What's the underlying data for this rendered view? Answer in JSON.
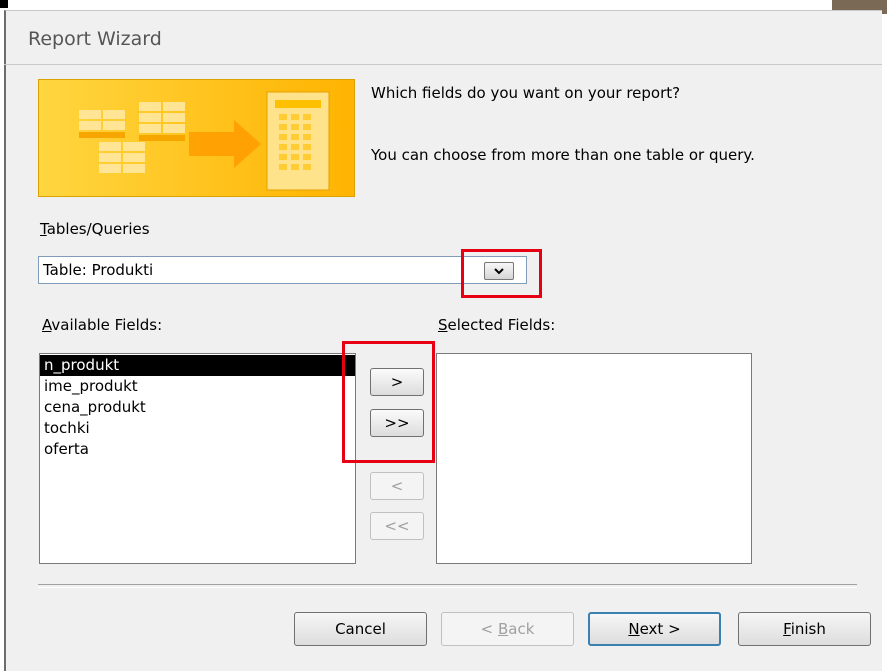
{
  "window": {
    "title": "Report Wizard"
  },
  "prompt": {
    "line1": "Which fields do you want on your report?",
    "line2": "You can choose from more than one table or query."
  },
  "tables_queries": {
    "label_accel": "T",
    "label_rest": "ables/Queries",
    "selected": "Table: Produkti"
  },
  "available": {
    "label_accel": "A",
    "label_rest": "vailable Fields:",
    "items": [
      "n_produkt",
      "ime_produkt",
      "cena_produkt",
      "tochki",
      "oferta"
    ],
    "selected_index": 0
  },
  "selected_fields": {
    "label_accel": "S",
    "label_rest": "elected Fields:",
    "items": []
  },
  "move_buttons": {
    "add_one": ">",
    "add_all": ">>",
    "remove_one": "<",
    "remove_all": "<<"
  },
  "footer": {
    "cancel": "Cancel",
    "back_pre": "< ",
    "back_accel": "B",
    "back_rest": "ack",
    "next_accel": "N",
    "next_rest": "ext >",
    "finish_accel": "F",
    "finish_rest": "inish"
  },
  "colors": {
    "highlight": "#e60012",
    "banner": "#ffc000",
    "selection": "#000000"
  },
  "icons": {
    "dropdown": "chevron-down-icon",
    "banner": "report-wizard-illustration"
  }
}
